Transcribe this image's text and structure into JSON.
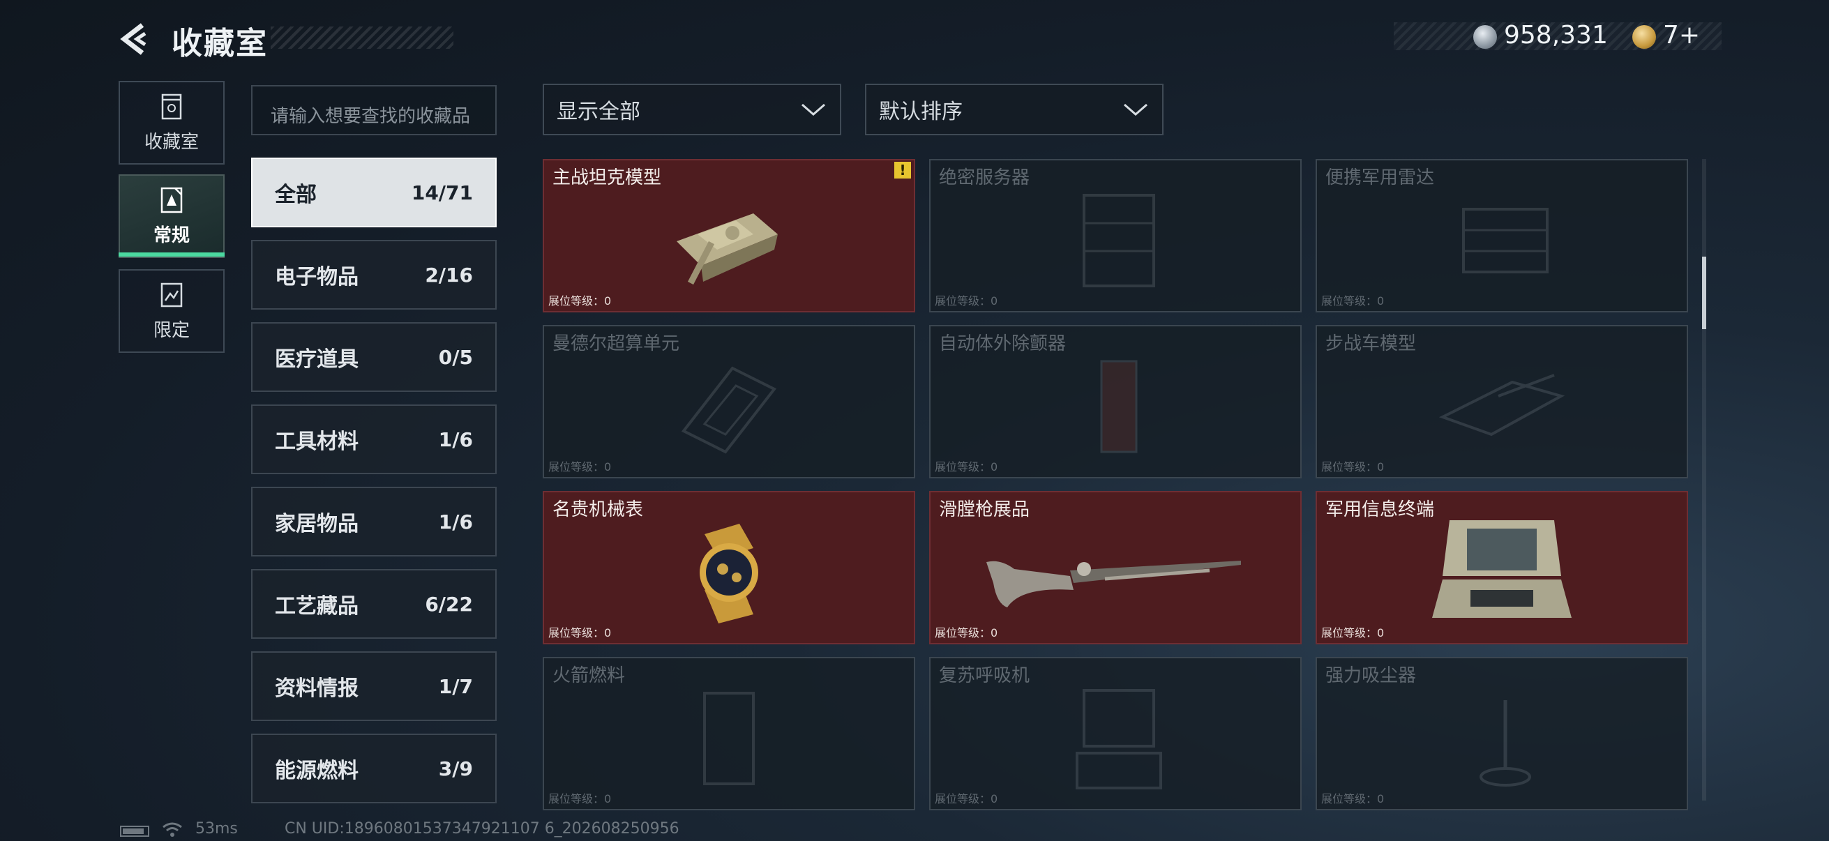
{
  "header": {
    "title": "收藏室",
    "coins": "958,331",
    "tokens": "7+"
  },
  "nav": {
    "items": [
      {
        "label": "收藏室",
        "icon": "trash-bin-icon"
      },
      {
        "label": "常规",
        "icon": "regular-collection-icon"
      },
      {
        "label": "限定",
        "icon": "limited-collection-icon"
      }
    ],
    "active_index": 1
  },
  "search": {
    "placeholder": "请输入想要查找的收藏品"
  },
  "categories": [
    {
      "label": "全部",
      "count": "14/71"
    },
    {
      "label": "电子物品",
      "count": "2/16"
    },
    {
      "label": "医疗道具",
      "count": "0/5"
    },
    {
      "label": "工具材料",
      "count": "1/6"
    },
    {
      "label": "家居物品",
      "count": "1/6"
    },
    {
      "label": "工艺藏品",
      "count": "6/22"
    },
    {
      "label": "资料情报",
      "count": "1/7"
    },
    {
      "label": "能源燃料",
      "count": "3/9"
    }
  ],
  "filters": {
    "show": "显示全部",
    "sort": "默认排序"
  },
  "level_label": "展位等级：0",
  "grid": [
    {
      "name": "主战坦克模型",
      "owned": true,
      "warning": "!",
      "icon": "tank-model-icon"
    },
    {
      "name": "绝密服务器",
      "owned": false,
      "icon": "server-icon"
    },
    {
      "name": "便携军用雷达",
      "owned": false,
      "icon": "radar-icon"
    },
    {
      "name": "曼德尔超算单元",
      "owned": false,
      "icon": "supercomputer-unit-icon"
    },
    {
      "name": "自动体外除颤器",
      "owned": false,
      "icon": "defibrillator-icon"
    },
    {
      "name": "步战车模型",
      "owned": false,
      "icon": "ifv-model-icon"
    },
    {
      "name": "名贵机械表",
      "owned": true,
      "icon": "watch-icon"
    },
    {
      "name": "滑膛枪展品",
      "owned": true,
      "icon": "musket-icon"
    },
    {
      "name": "军用信息终端",
      "owned": true,
      "icon": "terminal-icon"
    },
    {
      "name": "火箭燃料",
      "owned": false,
      "icon": "rocket-fuel-icon"
    },
    {
      "name": "复苏呼吸机",
      "owned": false,
      "icon": "ventilator-icon"
    },
    {
      "name": "强力吸尘器",
      "owned": false,
      "icon": "vacuum-icon"
    }
  ],
  "footer": {
    "ping": "53ms",
    "uid": "CN UID:18960801537347921107 6_202608250956"
  }
}
